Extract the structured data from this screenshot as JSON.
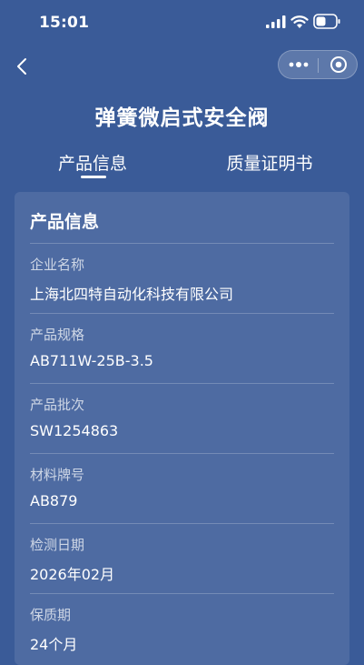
{
  "status_bar": {
    "time": "15:01",
    "icons": [
      "signal-icon",
      "wifi-icon",
      "battery-icon"
    ]
  },
  "nav": {
    "back_icon": "chevron-left-icon",
    "capsule_icons": [
      "more-dots-icon",
      "target-close-icon"
    ]
  },
  "page": {
    "title": "弹簧微启式安全阀"
  },
  "tabs": [
    {
      "label": "产品信息",
      "active": true
    },
    {
      "label": "质量证明书",
      "active": false
    }
  ],
  "card": {
    "title": "产品信息",
    "fields": [
      {
        "label": "企业名称",
        "value": "上海北四特自动化科技有限公司"
      },
      {
        "label": "产品规格",
        "value": "AB711W-25B-3.5"
      },
      {
        "label": "产品批次",
        "value": "SW1254863"
      },
      {
        "label": "材料牌号",
        "value": "AB879"
      },
      {
        "label": "检测日期",
        "value": "2026年02月"
      },
      {
        "label": "保质期",
        "value": "24个月"
      }
    ]
  },
  "colors": {
    "background": "#3a5b98",
    "text": "#ffffff"
  }
}
